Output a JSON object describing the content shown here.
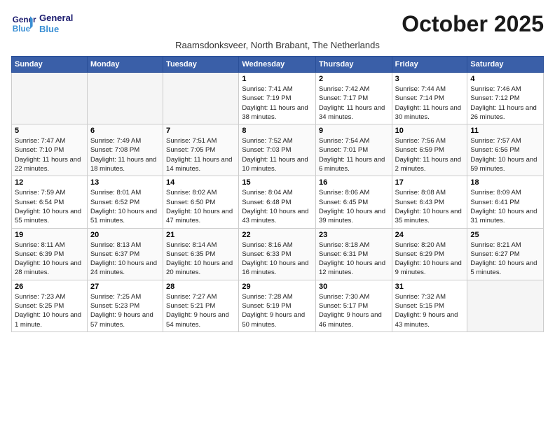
{
  "header": {
    "logo_line1": "General",
    "logo_line2": "Blue",
    "month_title": "October 2025",
    "subtitle": "Raamsdonksveer, North Brabant, The Netherlands"
  },
  "days_of_week": [
    "Sunday",
    "Monday",
    "Tuesday",
    "Wednesday",
    "Thursday",
    "Friday",
    "Saturday"
  ],
  "weeks": [
    [
      {
        "day": "",
        "empty": true
      },
      {
        "day": "",
        "empty": true
      },
      {
        "day": "",
        "empty": true
      },
      {
        "day": "1",
        "sunrise": "7:41 AM",
        "sunset": "7:19 PM",
        "daylight": "11 hours and 38 minutes."
      },
      {
        "day": "2",
        "sunrise": "7:42 AM",
        "sunset": "7:17 PM",
        "daylight": "11 hours and 34 minutes."
      },
      {
        "day": "3",
        "sunrise": "7:44 AM",
        "sunset": "7:14 PM",
        "daylight": "11 hours and 30 minutes."
      },
      {
        "day": "4",
        "sunrise": "7:46 AM",
        "sunset": "7:12 PM",
        "daylight": "11 hours and 26 minutes."
      }
    ],
    [
      {
        "day": "5",
        "sunrise": "7:47 AM",
        "sunset": "7:10 PM",
        "daylight": "11 hours and 22 minutes."
      },
      {
        "day": "6",
        "sunrise": "7:49 AM",
        "sunset": "7:08 PM",
        "daylight": "11 hours and 18 minutes."
      },
      {
        "day": "7",
        "sunrise": "7:51 AM",
        "sunset": "7:05 PM",
        "daylight": "11 hours and 14 minutes."
      },
      {
        "day": "8",
        "sunrise": "7:52 AM",
        "sunset": "7:03 PM",
        "daylight": "11 hours and 10 minutes."
      },
      {
        "day": "9",
        "sunrise": "7:54 AM",
        "sunset": "7:01 PM",
        "daylight": "11 hours and 6 minutes."
      },
      {
        "day": "10",
        "sunrise": "7:56 AM",
        "sunset": "6:59 PM",
        "daylight": "11 hours and 2 minutes."
      },
      {
        "day": "11",
        "sunrise": "7:57 AM",
        "sunset": "6:56 PM",
        "daylight": "10 hours and 59 minutes."
      }
    ],
    [
      {
        "day": "12",
        "sunrise": "7:59 AM",
        "sunset": "6:54 PM",
        "daylight": "10 hours and 55 minutes."
      },
      {
        "day": "13",
        "sunrise": "8:01 AM",
        "sunset": "6:52 PM",
        "daylight": "10 hours and 51 minutes."
      },
      {
        "day": "14",
        "sunrise": "8:02 AM",
        "sunset": "6:50 PM",
        "daylight": "10 hours and 47 minutes."
      },
      {
        "day": "15",
        "sunrise": "8:04 AM",
        "sunset": "6:48 PM",
        "daylight": "10 hours and 43 minutes."
      },
      {
        "day": "16",
        "sunrise": "8:06 AM",
        "sunset": "6:45 PM",
        "daylight": "10 hours and 39 minutes."
      },
      {
        "day": "17",
        "sunrise": "8:08 AM",
        "sunset": "6:43 PM",
        "daylight": "10 hours and 35 minutes."
      },
      {
        "day": "18",
        "sunrise": "8:09 AM",
        "sunset": "6:41 PM",
        "daylight": "10 hours and 31 minutes."
      }
    ],
    [
      {
        "day": "19",
        "sunrise": "8:11 AM",
        "sunset": "6:39 PM",
        "daylight": "10 hours and 28 minutes."
      },
      {
        "day": "20",
        "sunrise": "8:13 AM",
        "sunset": "6:37 PM",
        "daylight": "10 hours and 24 minutes."
      },
      {
        "day": "21",
        "sunrise": "8:14 AM",
        "sunset": "6:35 PM",
        "daylight": "10 hours and 20 minutes."
      },
      {
        "day": "22",
        "sunrise": "8:16 AM",
        "sunset": "6:33 PM",
        "daylight": "10 hours and 16 minutes."
      },
      {
        "day": "23",
        "sunrise": "8:18 AM",
        "sunset": "6:31 PM",
        "daylight": "10 hours and 12 minutes."
      },
      {
        "day": "24",
        "sunrise": "8:20 AM",
        "sunset": "6:29 PM",
        "daylight": "10 hours and 9 minutes."
      },
      {
        "day": "25",
        "sunrise": "8:21 AM",
        "sunset": "6:27 PM",
        "daylight": "10 hours and 5 minutes."
      }
    ],
    [
      {
        "day": "26",
        "sunrise": "7:23 AM",
        "sunset": "5:25 PM",
        "daylight": "10 hours and 1 minute."
      },
      {
        "day": "27",
        "sunrise": "7:25 AM",
        "sunset": "5:23 PM",
        "daylight": "9 hours and 57 minutes."
      },
      {
        "day": "28",
        "sunrise": "7:27 AM",
        "sunset": "5:21 PM",
        "daylight": "9 hours and 54 minutes."
      },
      {
        "day": "29",
        "sunrise": "7:28 AM",
        "sunset": "5:19 PM",
        "daylight": "9 hours and 50 minutes."
      },
      {
        "day": "30",
        "sunrise": "7:30 AM",
        "sunset": "5:17 PM",
        "daylight": "9 hours and 46 minutes."
      },
      {
        "day": "31",
        "sunrise": "7:32 AM",
        "sunset": "5:15 PM",
        "daylight": "9 hours and 43 minutes."
      },
      {
        "day": "",
        "empty": true
      }
    ]
  ]
}
